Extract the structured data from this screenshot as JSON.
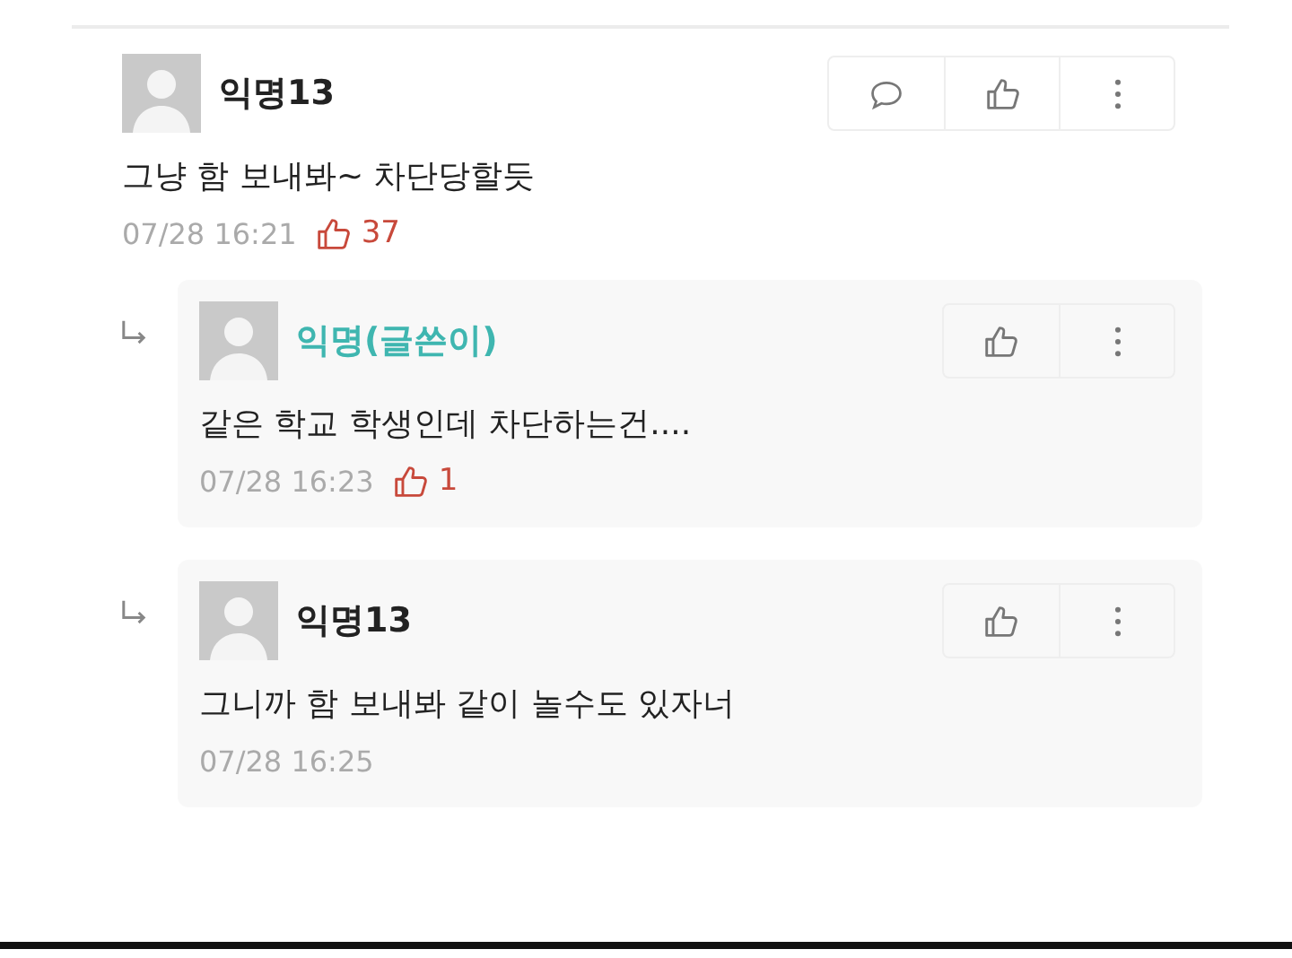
{
  "comments": [
    {
      "author": "익명13",
      "is_writer": false,
      "text": "그냥 함 보내봐~ 차단당할듯",
      "time": "07/28 16:21",
      "likes": "37",
      "actions": [
        {
          "kind": "comment"
        },
        {
          "kind": "like"
        },
        {
          "kind": "more"
        }
      ],
      "children": [
        {
          "author": "익명(글쓴이)",
          "is_writer": true,
          "text": "같은 학교 학생인데 차단하는건....",
          "time": "07/28 16:23",
          "likes": "1",
          "actions": [
            {
              "kind": "like"
            },
            {
              "kind": "more"
            }
          ]
        },
        {
          "author": "익명13",
          "is_writer": false,
          "text": "그니까 함 보내봐 같이 놀수도 있자너",
          "time": "07/28 16:25",
          "actions": [
            {
              "kind": "like"
            },
            {
              "kind": "more"
            }
          ]
        }
      ]
    }
  ]
}
